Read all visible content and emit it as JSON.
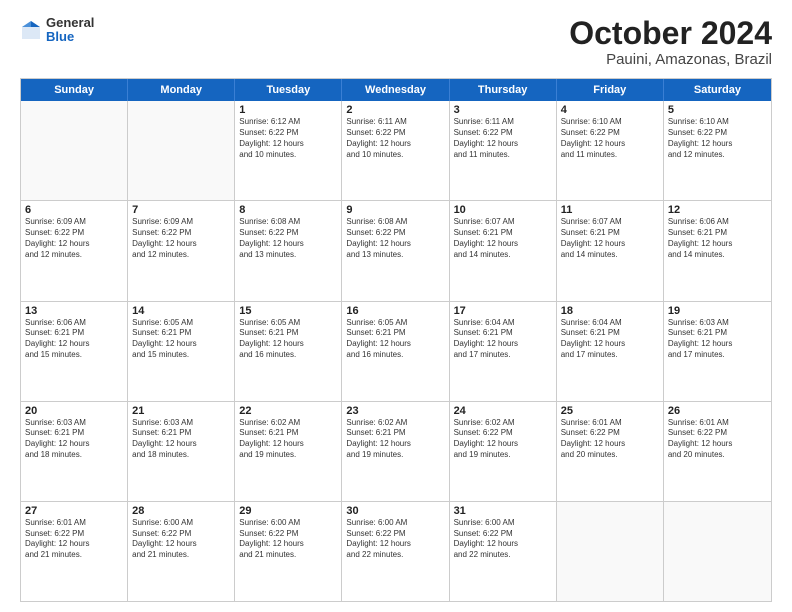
{
  "logo": {
    "general": "General",
    "blue": "Blue"
  },
  "title": "October 2024",
  "subtitle": "Pauini, Amazonas, Brazil",
  "days": [
    "Sunday",
    "Monday",
    "Tuesday",
    "Wednesday",
    "Thursday",
    "Friday",
    "Saturday"
  ],
  "weeks": [
    [
      {
        "day": "",
        "text": "",
        "empty": true
      },
      {
        "day": "",
        "text": "",
        "empty": true
      },
      {
        "day": "1",
        "text": "Sunrise: 6:12 AM\nSunset: 6:22 PM\nDaylight: 12 hours\nand 10 minutes."
      },
      {
        "day": "2",
        "text": "Sunrise: 6:11 AM\nSunset: 6:22 PM\nDaylight: 12 hours\nand 10 minutes."
      },
      {
        "day": "3",
        "text": "Sunrise: 6:11 AM\nSunset: 6:22 PM\nDaylight: 12 hours\nand 11 minutes."
      },
      {
        "day": "4",
        "text": "Sunrise: 6:10 AM\nSunset: 6:22 PM\nDaylight: 12 hours\nand 11 minutes."
      },
      {
        "day": "5",
        "text": "Sunrise: 6:10 AM\nSunset: 6:22 PM\nDaylight: 12 hours\nand 12 minutes."
      }
    ],
    [
      {
        "day": "6",
        "text": "Sunrise: 6:09 AM\nSunset: 6:22 PM\nDaylight: 12 hours\nand 12 minutes."
      },
      {
        "day": "7",
        "text": "Sunrise: 6:09 AM\nSunset: 6:22 PM\nDaylight: 12 hours\nand 12 minutes."
      },
      {
        "day": "8",
        "text": "Sunrise: 6:08 AM\nSunset: 6:22 PM\nDaylight: 12 hours\nand 13 minutes."
      },
      {
        "day": "9",
        "text": "Sunrise: 6:08 AM\nSunset: 6:22 PM\nDaylight: 12 hours\nand 13 minutes."
      },
      {
        "day": "10",
        "text": "Sunrise: 6:07 AM\nSunset: 6:21 PM\nDaylight: 12 hours\nand 14 minutes."
      },
      {
        "day": "11",
        "text": "Sunrise: 6:07 AM\nSunset: 6:21 PM\nDaylight: 12 hours\nand 14 minutes."
      },
      {
        "day": "12",
        "text": "Sunrise: 6:06 AM\nSunset: 6:21 PM\nDaylight: 12 hours\nand 14 minutes."
      }
    ],
    [
      {
        "day": "13",
        "text": "Sunrise: 6:06 AM\nSunset: 6:21 PM\nDaylight: 12 hours\nand 15 minutes."
      },
      {
        "day": "14",
        "text": "Sunrise: 6:05 AM\nSunset: 6:21 PM\nDaylight: 12 hours\nand 15 minutes."
      },
      {
        "day": "15",
        "text": "Sunrise: 6:05 AM\nSunset: 6:21 PM\nDaylight: 12 hours\nand 16 minutes."
      },
      {
        "day": "16",
        "text": "Sunrise: 6:05 AM\nSunset: 6:21 PM\nDaylight: 12 hours\nand 16 minutes."
      },
      {
        "day": "17",
        "text": "Sunrise: 6:04 AM\nSunset: 6:21 PM\nDaylight: 12 hours\nand 17 minutes."
      },
      {
        "day": "18",
        "text": "Sunrise: 6:04 AM\nSunset: 6:21 PM\nDaylight: 12 hours\nand 17 minutes."
      },
      {
        "day": "19",
        "text": "Sunrise: 6:03 AM\nSunset: 6:21 PM\nDaylight: 12 hours\nand 17 minutes."
      }
    ],
    [
      {
        "day": "20",
        "text": "Sunrise: 6:03 AM\nSunset: 6:21 PM\nDaylight: 12 hours\nand 18 minutes."
      },
      {
        "day": "21",
        "text": "Sunrise: 6:03 AM\nSunset: 6:21 PM\nDaylight: 12 hours\nand 18 minutes."
      },
      {
        "day": "22",
        "text": "Sunrise: 6:02 AM\nSunset: 6:21 PM\nDaylight: 12 hours\nand 19 minutes."
      },
      {
        "day": "23",
        "text": "Sunrise: 6:02 AM\nSunset: 6:21 PM\nDaylight: 12 hours\nand 19 minutes."
      },
      {
        "day": "24",
        "text": "Sunrise: 6:02 AM\nSunset: 6:22 PM\nDaylight: 12 hours\nand 19 minutes."
      },
      {
        "day": "25",
        "text": "Sunrise: 6:01 AM\nSunset: 6:22 PM\nDaylight: 12 hours\nand 20 minutes."
      },
      {
        "day": "26",
        "text": "Sunrise: 6:01 AM\nSunset: 6:22 PM\nDaylight: 12 hours\nand 20 minutes."
      }
    ],
    [
      {
        "day": "27",
        "text": "Sunrise: 6:01 AM\nSunset: 6:22 PM\nDaylight: 12 hours\nand 21 minutes."
      },
      {
        "day": "28",
        "text": "Sunrise: 6:00 AM\nSunset: 6:22 PM\nDaylight: 12 hours\nand 21 minutes."
      },
      {
        "day": "29",
        "text": "Sunrise: 6:00 AM\nSunset: 6:22 PM\nDaylight: 12 hours\nand 21 minutes."
      },
      {
        "day": "30",
        "text": "Sunrise: 6:00 AM\nSunset: 6:22 PM\nDaylight: 12 hours\nand 22 minutes."
      },
      {
        "day": "31",
        "text": "Sunrise: 6:00 AM\nSunset: 6:22 PM\nDaylight: 12 hours\nand 22 minutes."
      },
      {
        "day": "",
        "text": "",
        "empty": true
      },
      {
        "day": "",
        "text": "",
        "empty": true
      }
    ]
  ]
}
